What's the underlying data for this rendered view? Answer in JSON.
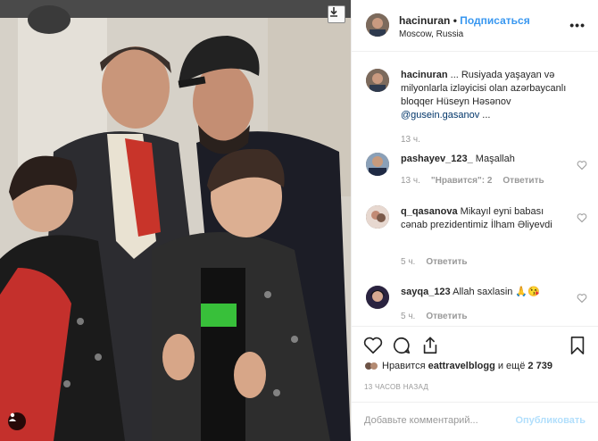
{
  "post": {
    "username": "hacinuran",
    "follow_label": "Подписаться",
    "separator": "•",
    "location": "Moscow, Russia",
    "more_label": "•••"
  },
  "caption": {
    "username": "hacinuran",
    "text": " ... Rusiyada yaşayan və milyonlarla izləyicisi olan azərbaycanlı bloqqer Hüseyn Həsənov ",
    "mention": "@gusein.gasanov",
    "suffix": " ...",
    "time": "13 ч."
  },
  "comments": [
    {
      "username": "pashayev_123_",
      "text": " Maşallah",
      "time": "13 ч.",
      "likes": "\"Нравится\": 2",
      "reply": "Ответить"
    },
    {
      "username": "q_qasanova",
      "text": " Mikayıl eyni babası cənab prezidentimiz İlham Əliyevdi",
      "time": "5 ч.",
      "reply": "Ответить"
    },
    {
      "username": "sayqa_123",
      "text": " Allah saxlasin 🙏😘",
      "time": "5 ч.",
      "reply": "Ответить"
    }
  ],
  "likes": {
    "prefix": "Нравится ",
    "user": "eattravelblogg",
    "suffix": " и ещё ",
    "count": "2 739"
  },
  "time_ago": "13 ЧАСОВ НАЗАД",
  "add_comment": {
    "placeholder": "Добавьте комментарий...",
    "publish_label": "Опубликовать"
  },
  "colors": {
    "accent": "#3897f0",
    "publish_disabled": "#b2dffc",
    "muted": "#999999",
    "text": "#262626"
  },
  "icons": [
    "download-icon",
    "user-tag-icon",
    "more-icon",
    "heart-icon",
    "comment-icon",
    "share-icon",
    "bookmark-icon"
  ]
}
